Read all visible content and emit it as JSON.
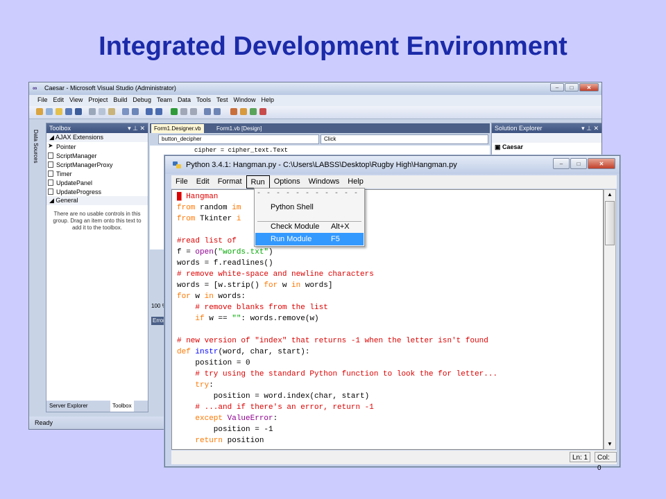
{
  "slide": {
    "title": "Integrated Development Environment"
  },
  "vs": {
    "title": "Caesar - Microsoft Visual Studio (Administrator)",
    "menu": [
      "File",
      "Edit",
      "View",
      "Project",
      "Build",
      "Debug",
      "Team",
      "Data",
      "Tools",
      "Test",
      "Window",
      "Help"
    ],
    "data_sources_tab": "Data Sources",
    "toolbox": {
      "title": "Toolbox",
      "group_ajax": "AJAX Extensions",
      "items": [
        "Pointer",
        "ScriptManager",
        "ScriptManagerProxy",
        "Timer",
        "UpdatePanel",
        "UpdateProgress"
      ],
      "group_general": "General",
      "empty_note": "There are no usable controls in this group. Drag an item onto this text to add it to the toolbox.",
      "bottom_tabs": [
        "Server Explorer",
        "Toolbox"
      ]
    },
    "doc_tabs": [
      "Form1.Designer.vb",
      "Form1.vb [Design]"
    ],
    "combo_left": "button_decipher",
    "combo_right": "Click",
    "code_line": "cipher = cipher_text.Text",
    "zoom": "100 %",
    "error_list": "Error",
    "solution_explorer": {
      "title": "Solution Explorer",
      "root": "Caesar"
    },
    "status": "Ready"
  },
  "idle": {
    "title": "Python 3.4.1: Hangman.py - C:\\Users\\LABSS\\Desktop\\Rugby High\\Hangman.py",
    "menu": [
      "File",
      "Edit",
      "Format",
      "Run",
      "Options",
      "Windows",
      "Help"
    ],
    "run_menu": {
      "tearoff": "- - - - - - - - - - - - -",
      "items": [
        {
          "label": "Python Shell",
          "accel": ""
        },
        {
          "label": "Check Module",
          "accel": "Alt+X"
        },
        {
          "label": "Run Module",
          "accel": "F5"
        }
      ]
    },
    "status": {
      "line": "Ln: 1",
      "col": "Col: 0"
    }
  }
}
